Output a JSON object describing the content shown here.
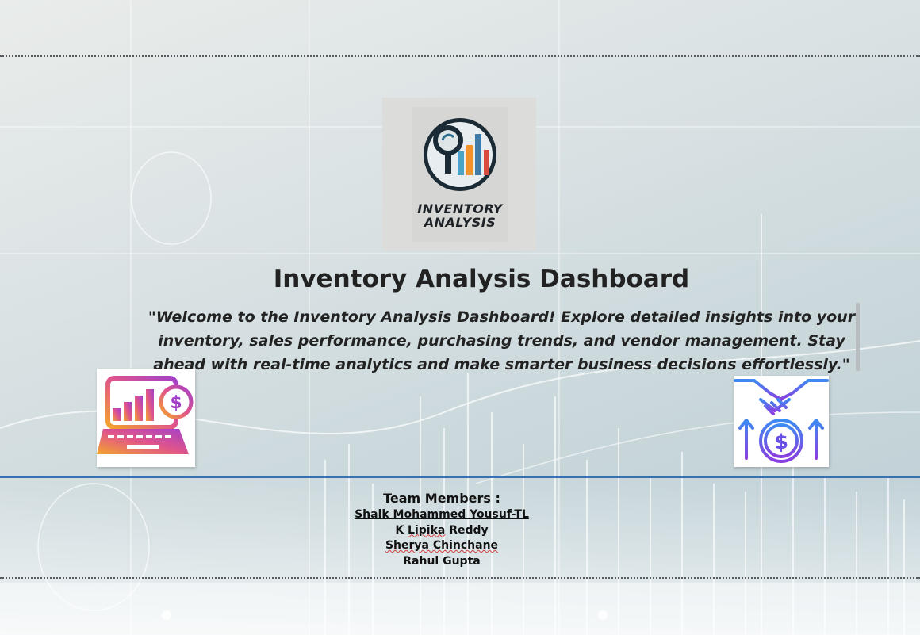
{
  "logo": {
    "text": "INVENTORY ANALYSIS",
    "icon": "magnifier-bar-chart-icon"
  },
  "title": "Inventory Analysis Dashboard",
  "welcome_text": "\"Welcome to the Inventory Analysis Dashboard! Explore detailed insights into your inventory, sales performance, purchasing trends, and vendor management. Stay ahead with real-time analytics and make smarter business decisions effortlessly.\"",
  "left_icon": "laptop-growth-dollar-icon",
  "right_icon": "handshake-dollar-growth-icon",
  "team": {
    "heading": "Team Members :",
    "members": [
      "Shaik Mohammed Yousuf-TL",
      "K Lipika Reddy",
      "Sherya Chinchane",
      "Rahul Gupta"
    ]
  },
  "colors": {
    "accent_line": "#3a6fb0",
    "title_text": "#222222",
    "icon_gradient_start": "#f4a52c",
    "icon_gradient_end": "#a340c9",
    "icon_blue": "#3d8bf2",
    "icon_purple": "#8a3fe0"
  }
}
